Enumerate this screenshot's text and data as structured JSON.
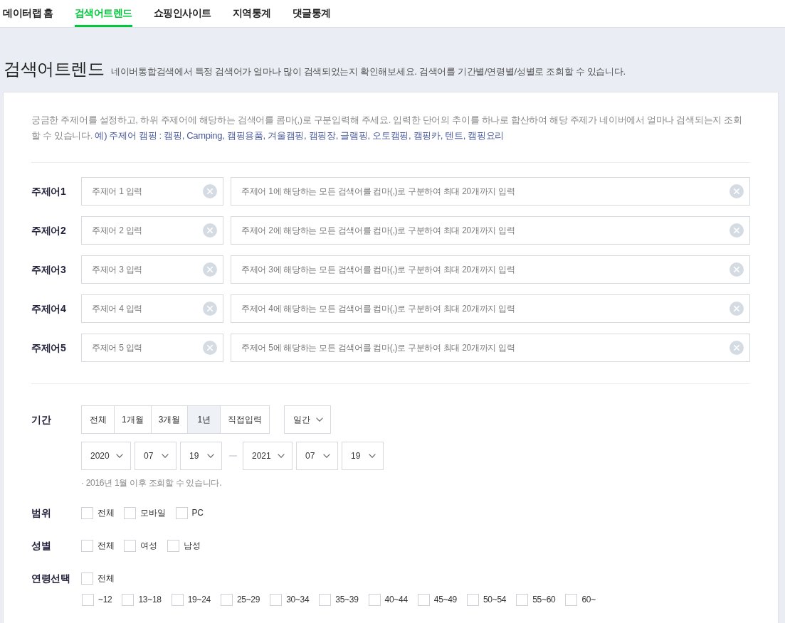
{
  "nav": {
    "tabs": [
      {
        "label": "데이터랩 홈",
        "selected": false
      },
      {
        "label": "검색어트렌드",
        "selected": true
      },
      {
        "label": "쇼핑인사이트",
        "selected": false
      },
      {
        "label": "지역통계",
        "selected": false
      },
      {
        "label": "댓글통계",
        "selected": false
      }
    ]
  },
  "header": {
    "title": "검색어트렌드",
    "subtitle": "네이버통합검색에서 특정 검색어가 얼마나 많이 검색되었는지 확인해보세요. 검색어를 기간별/연령별/성별로 조회할 수 있습니다."
  },
  "intro": {
    "text": "궁금한 주제어를 설정하고, 하위 주제어에 해당하는 검색어를 콤마(,)로 구분입력해 주세요. 입력한 단어의 추이를 하나로 합산하여 해당 주제가 네이버에서 얼마나 검색되는지 조회할 수 있습니다.",
    "example": "예) 주제어 캠핑 : 캠핑, Camping, 캠핑용품, 겨울캠핑, 캠핑장, 글램핑, 오토캠핑, 캠핑카, 텐트, 캠핑요리"
  },
  "topics": [
    {
      "label": "주제어1",
      "name_placeholder": "주제어 1 입력",
      "keywords_placeholder": "주제어 1에 해당하는 모든 검색어를 컴마(,)로 구분하여 최대 20개까지 입력"
    },
    {
      "label": "주제어2",
      "name_placeholder": "주제어 2 입력",
      "keywords_placeholder": "주제어 2에 해당하는 모든 검색어를 컴마(,)로 구분하여 최대 20개까지 입력"
    },
    {
      "label": "주제어3",
      "name_placeholder": "주제어 3 입력",
      "keywords_placeholder": "주제어 3에 해당하는 모든 검색어를 컴마(,)로 구분하여 최대 20개까지 입력"
    },
    {
      "label": "주제어4",
      "name_placeholder": "주제어 4 입력",
      "keywords_placeholder": "주제어 4에 해당하는 모든 검색어를 컴마(,)로 구분하여 최대 20개까지 입력"
    },
    {
      "label": "주제어5",
      "name_placeholder": "주제어 5 입력",
      "keywords_placeholder": "주제어 5에 해당하는 모든 검색어를 컴마(,)로 구분하여 최대 20개까지 입력"
    }
  ],
  "period": {
    "label": "기간",
    "options": [
      {
        "label": "전체",
        "selected": false
      },
      {
        "label": "1개월",
        "selected": false
      },
      {
        "label": "3개월",
        "selected": false
      },
      {
        "label": "1년",
        "selected": true
      },
      {
        "label": "직접입력",
        "selected": false
      }
    ],
    "interval": "일간",
    "start": {
      "year": "2020",
      "month": "07",
      "day": "19"
    },
    "end": {
      "year": "2021",
      "month": "07",
      "day": "19"
    },
    "note": "· 2016년 1월 이후 조회할 수 있습니다."
  },
  "scope": {
    "label": "범위",
    "options": [
      {
        "label": "전체",
        "checked": false
      },
      {
        "label": "모바일",
        "checked": false
      },
      {
        "label": "PC",
        "checked": false
      }
    ]
  },
  "gender": {
    "label": "성별",
    "options": [
      {
        "label": "전체",
        "checked": false
      },
      {
        "label": "여성",
        "checked": false
      },
      {
        "label": "남성",
        "checked": false
      }
    ]
  },
  "age": {
    "label": "연령선택",
    "all": {
      "label": "전체",
      "checked": false
    },
    "options": [
      {
        "label": "~12",
        "checked": false
      },
      {
        "label": "13~18",
        "checked": false
      },
      {
        "label": "19~24",
        "checked": false
      },
      {
        "label": "25~29",
        "checked": false
      },
      {
        "label": "30~34",
        "checked": false
      },
      {
        "label": "35~39",
        "checked": false
      },
      {
        "label": "40~44",
        "checked": false
      },
      {
        "label": "45~49",
        "checked": false
      },
      {
        "label": "50~54",
        "checked": false
      },
      {
        "label": "55~60",
        "checked": false
      },
      {
        "label": "60~",
        "checked": false
      }
    ]
  }
}
